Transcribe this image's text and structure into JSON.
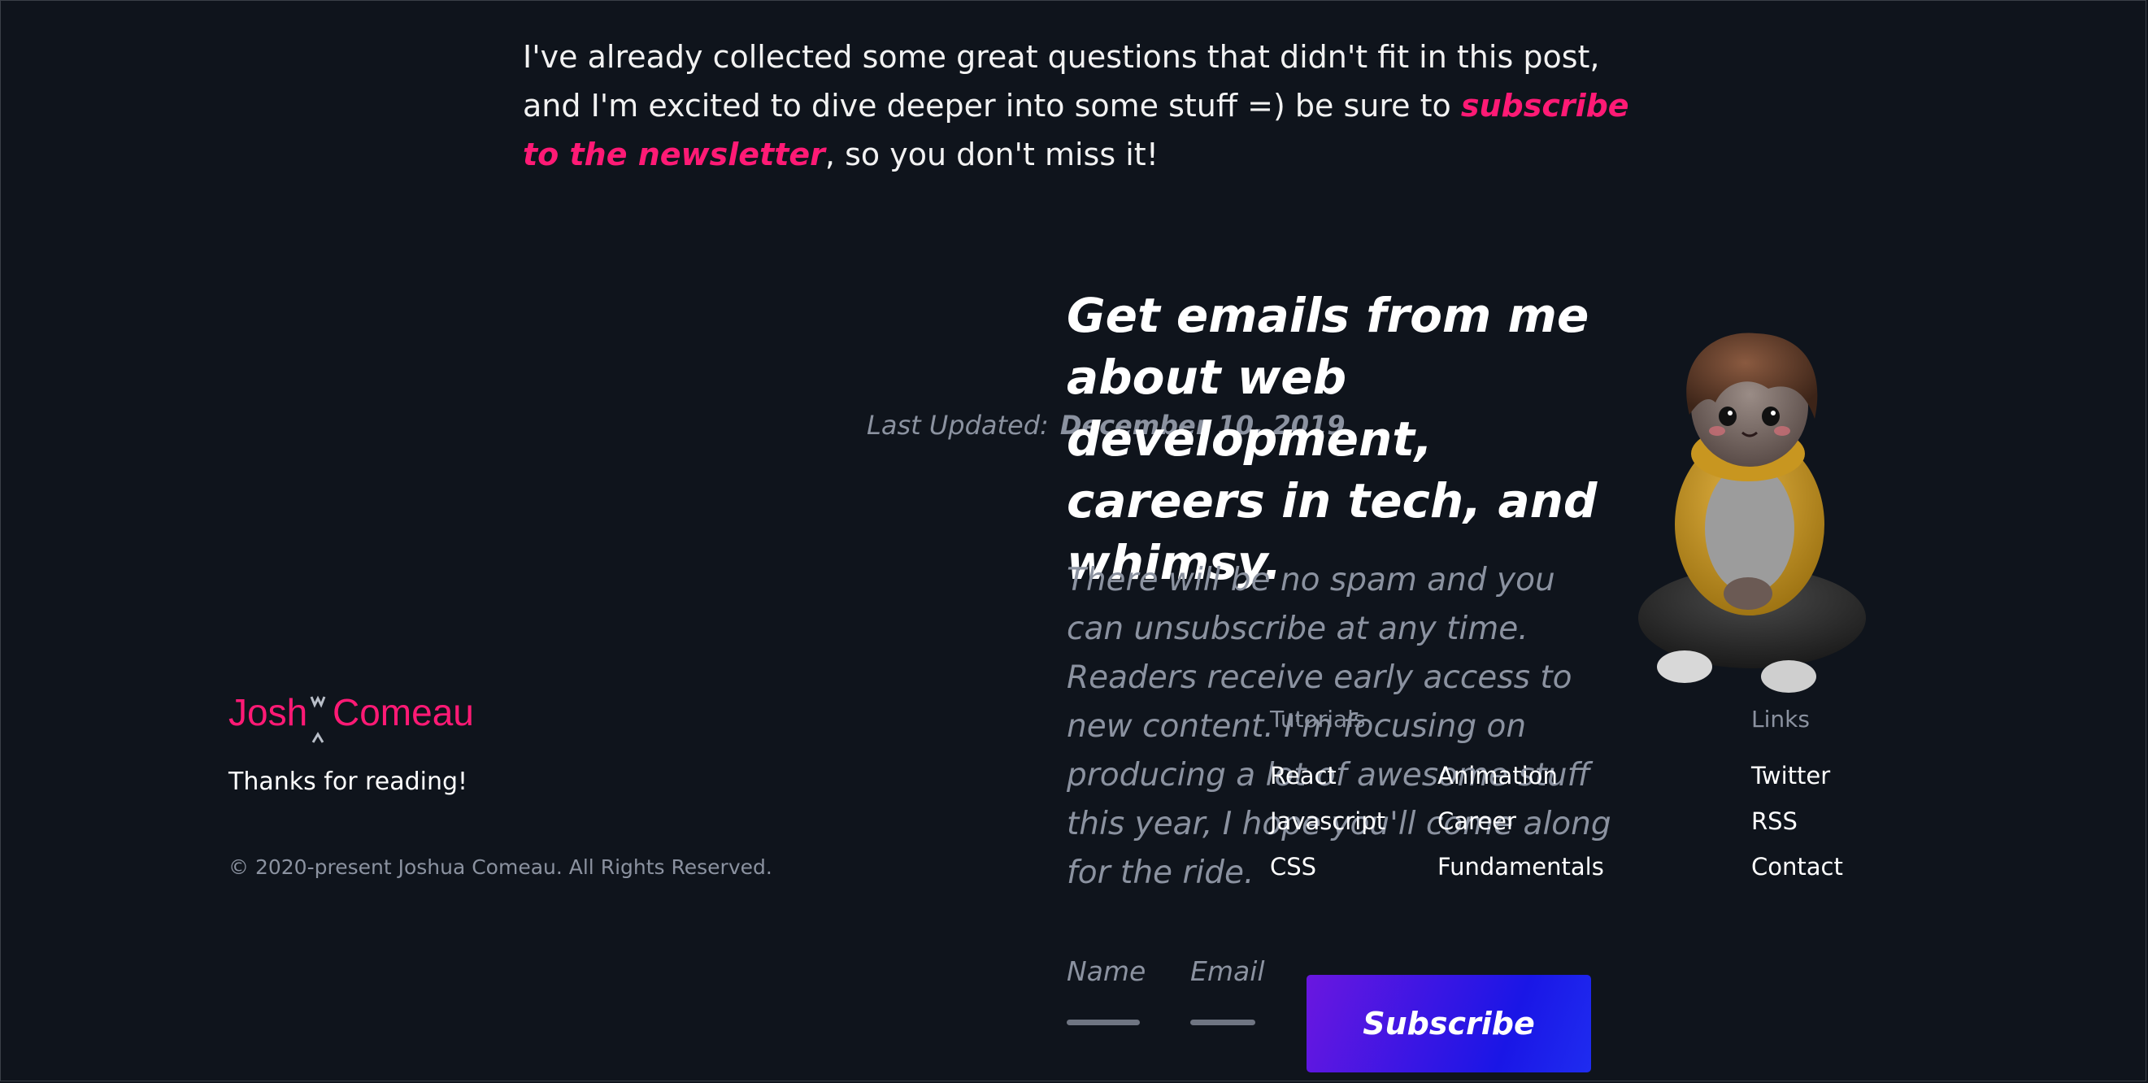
{
  "article": {
    "intro_before": "I've already collected some great questions that didn't fit in this post, and I'm excited to dive deeper into some stuff =) be sure to ",
    "intro_link": "subscribe to the newsletter",
    "intro_after": ", so you don't miss it!"
  },
  "last_updated": {
    "label": "Last Updated:",
    "date": "December 10, 2019"
  },
  "newsletter": {
    "title": "Get emails from me about web development, careers in tech, and whimsy.",
    "description": "There will be no spam and you can unsubscribe at any time. Readers receive early access to new content. I'm focusing on producing a lot of awesome stuff this year, I hope you'll come along for the ride.",
    "name_placeholder": "Name",
    "email_placeholder": "Email",
    "subscribe_label": "Subscribe"
  },
  "footer": {
    "logo_first": "Josh",
    "logo_last": "Comeau",
    "thanks": "Thanks for reading!",
    "copyright": "© 2020-present Joshua Comeau. All Rights Reserved.",
    "tutorials_heading": "Tutorials",
    "tutorials_col1": [
      "React",
      "Javascript",
      "CSS"
    ],
    "tutorials_col2": [
      "Animation",
      "Career",
      "Fundamentals"
    ],
    "links_heading": "Links",
    "links": [
      "Twitter",
      "RSS",
      "Contact"
    ]
  },
  "colors": {
    "background": "#0f141c",
    "accent_pink": "#ff1a75",
    "muted_text": "#8b92a0",
    "button_gradient_start": "#6a17e0",
    "button_gradient_end": "#1a16e6"
  }
}
